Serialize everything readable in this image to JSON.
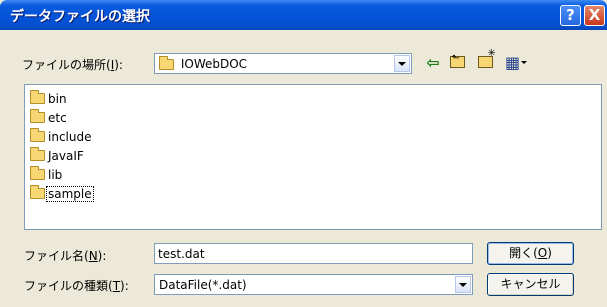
{
  "window": {
    "title": "データファイルの選択",
    "help_glyph": "?",
    "close_glyph": "X"
  },
  "look_in": {
    "label_prefix": "ファイルの場所(",
    "label_key": "I",
    "label_suffix": "):",
    "value": "IOWebDOC"
  },
  "toolbar": {
    "back_glyph": "⇦",
    "up_glyph": "⬑",
    "new_folder_glyph": "✳",
    "view_glyph": "▦"
  },
  "files": [
    {
      "name": "bin",
      "icon": "folder-icon"
    },
    {
      "name": "etc",
      "icon": "folder-icon"
    },
    {
      "name": "include",
      "icon": "folder-icon"
    },
    {
      "name": "JavaIF",
      "icon": "folder-icon"
    },
    {
      "name": "lib",
      "icon": "folder-icon"
    },
    {
      "name": "sample",
      "icon": "folder-icon"
    }
  ],
  "filename": {
    "label_prefix": "ファイル名(",
    "label_key": "N",
    "label_suffix": "):",
    "value": "test.dat"
  },
  "filetype": {
    "label_prefix": "ファイルの種類(",
    "label_key": "T",
    "label_suffix": "):",
    "value": "DataFile(*.dat)"
  },
  "buttons": {
    "open_prefix": "開く(",
    "open_key": "O",
    "open_suffix": ")",
    "cancel": "キャンセル"
  },
  "colors": {
    "titlebar": "#0453D8",
    "dialog_bg": "#ECE9D8",
    "field_border": "#7F9DB9"
  }
}
